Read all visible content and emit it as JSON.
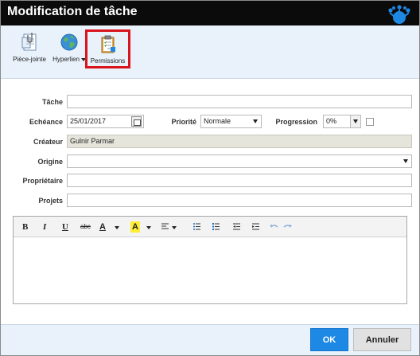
{
  "window": {
    "title": "Modification de tâche"
  },
  "toolbar": {
    "attachment_label": "Pièce-jointe",
    "hyperlink_label": "Hyperlien",
    "permissions_label": "Permissions"
  },
  "form": {
    "task": {
      "label": "Tâche",
      "value": ""
    },
    "due_date": {
      "label": "Echéance",
      "value": "25/01/2017"
    },
    "priority": {
      "label": "Priorité",
      "value": "Normale"
    },
    "progress": {
      "label": "Progression",
      "value": "0%"
    },
    "creator": {
      "label": "Créateur",
      "value": "Gulnir Parmar"
    },
    "origin": {
      "label": "Origine",
      "value": ""
    },
    "owner": {
      "label": "Propriétaire",
      "value": ""
    },
    "projects": {
      "label": "Projets",
      "value": ""
    }
  },
  "editor": {
    "bold": "B",
    "italic": "I",
    "underline": "U",
    "strike": "abc",
    "font_color": "A",
    "highlight": "A",
    "content": ""
  },
  "buttons": {
    "ok": "OK",
    "cancel": "Annuler"
  },
  "icons": {
    "attachment": "attachment-icon",
    "hyperlink": "globe-icon",
    "permissions": "clipboard-checklist-icon",
    "logo": "blue-crown-logo"
  },
  "colors": {
    "titlebar": "#0b0b0b",
    "toolbar_bg": "#e9f2fb",
    "highlight_border": "#d9141d",
    "ok_button": "#1e88e5",
    "readonly_bg": "#e5e5dc"
  }
}
